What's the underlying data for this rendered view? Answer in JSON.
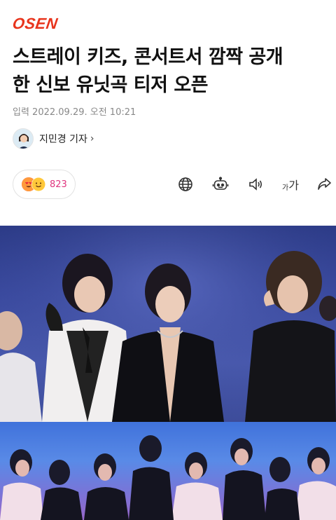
{
  "brand": {
    "logo_text": "OSEN",
    "accent": "#e8341c"
  },
  "article": {
    "title_line1": "스트레이 키즈, 콘서트서 깜짝 공개",
    "title_line2": "한 신보 유닛곡 티저 오픈",
    "dateline": "입력 2022.09.29. 오전 10:21"
  },
  "reporter": {
    "name": "지민경 기자",
    "chevron": "›"
  },
  "reactions": {
    "count": "823",
    "emoji_names": [
      "heart-eyes-emoji",
      "smile-emoji"
    ],
    "count_color": "#e0357f"
  },
  "toolbar": {
    "icons": [
      "globe-icon",
      "robot-summary-icon",
      "speaker-icon",
      "font-size-icon",
      "share-icon"
    ],
    "font_size_small": "가",
    "font_size_large": "가"
  },
  "photo": {
    "top_color": "#3a4aa0",
    "bottom_color": "#5d8ee8"
  }
}
